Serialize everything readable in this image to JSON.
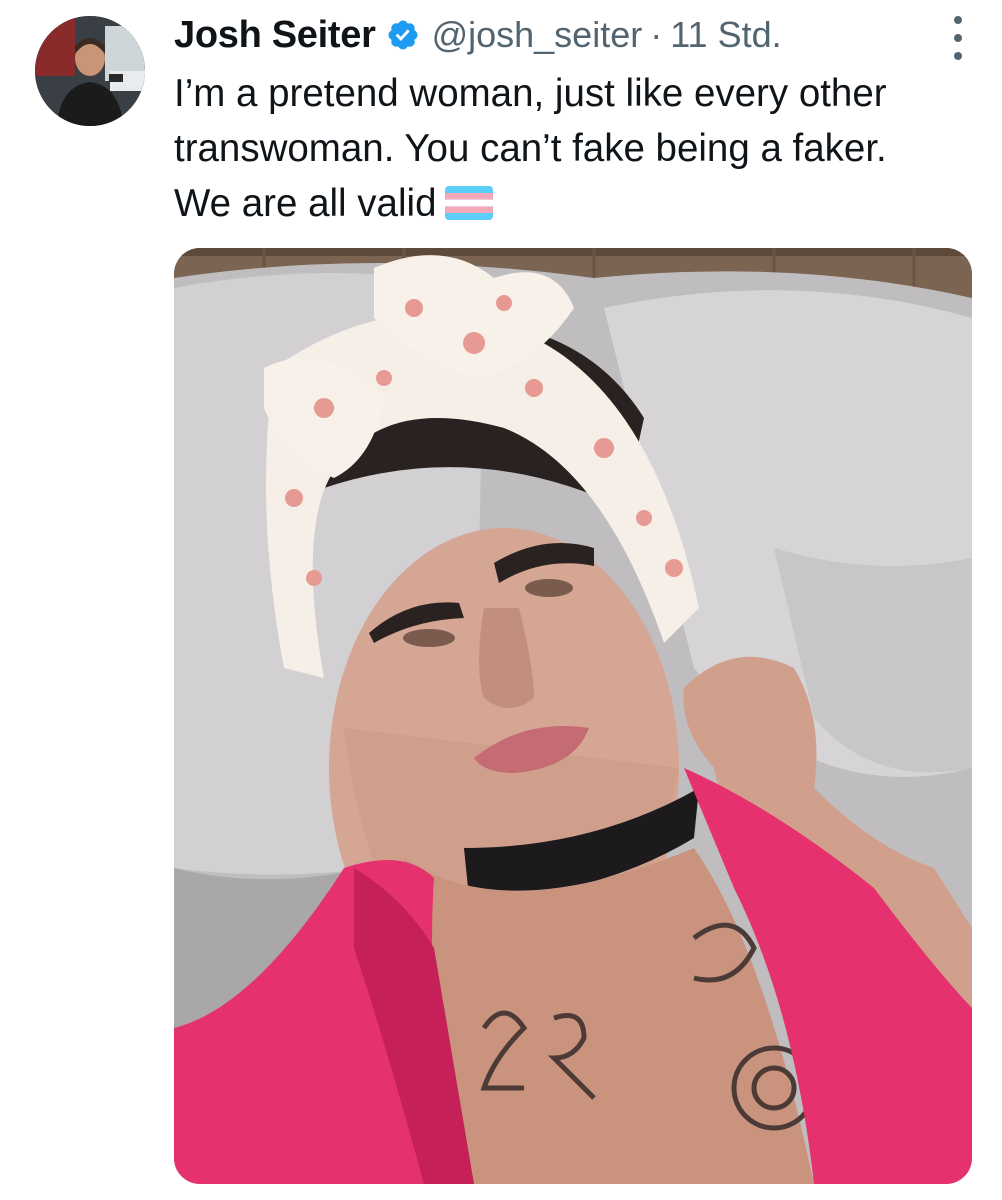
{
  "author": {
    "display_name": "Josh Seiter",
    "handle": "@josh_seiter",
    "separator": "·",
    "time": "11 Std.",
    "verified": true,
    "avatar_icon": "profile-photo"
  },
  "tweet": {
    "lines": [
      "I’m a pretend woman, just like every other",
      "transwoman. You can’t fake being a faker.",
      "We are all valid"
    ],
    "emoji": "transgender-flag"
  },
  "media": {
    "type": "photo",
    "icon": "photo-image"
  },
  "icons": {
    "verified": "verified-badge-icon",
    "more": "more-options-icon"
  },
  "colors": {
    "text": "#0f1419",
    "secondary": "#536471",
    "verified": "#1d9bf0",
    "flag_blue": "#5bcefa",
    "flag_pink": "#f5a9b8",
    "shirt_pink": "#e5326e"
  }
}
